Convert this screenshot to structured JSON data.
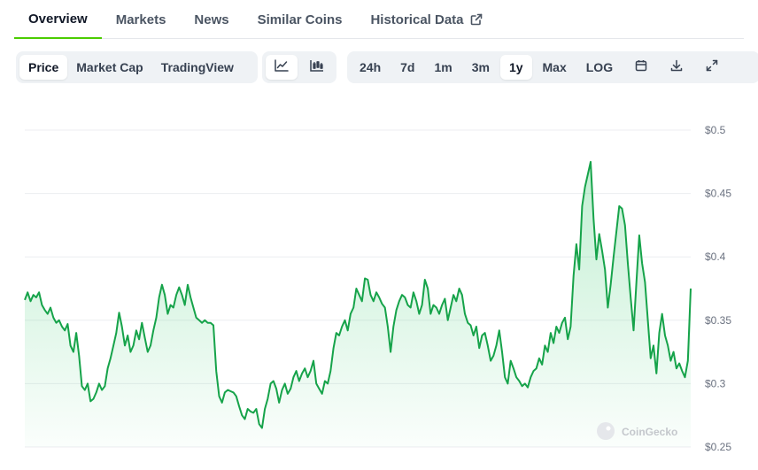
{
  "tabs": [
    {
      "label": "Overview",
      "active": true
    },
    {
      "label": "Markets",
      "active": false
    },
    {
      "label": "News",
      "active": false
    },
    {
      "label": "Similar Coins",
      "active": false
    },
    {
      "label": "Historical Data",
      "active": false,
      "external": true
    }
  ],
  "chart_type_buttons": [
    {
      "label": "Price",
      "active": true
    },
    {
      "label": "Market Cap",
      "active": false
    },
    {
      "label": "TradingView",
      "active": false
    }
  ],
  "view_icons": [
    {
      "icon": "line-chart-icon",
      "active": true
    },
    {
      "icon": "candlestick-chart-icon",
      "active": false
    }
  ],
  "range_buttons": [
    {
      "label": "24h",
      "active": false
    },
    {
      "label": "7d",
      "active": false
    },
    {
      "label": "1m",
      "active": false
    },
    {
      "label": "3m",
      "active": false
    },
    {
      "label": "1y",
      "active": true
    },
    {
      "label": "Max",
      "active": false
    },
    {
      "label": "LOG",
      "active": false
    }
  ],
  "tool_icons": [
    "calendar-icon",
    "download-icon",
    "expand-icon"
  ],
  "watermark": "CoinGecko",
  "colors": {
    "line": "#16a34a",
    "accent": "#4bcc00"
  },
  "chart_data": {
    "type": "area",
    "x_count": 220,
    "y_values": [
      0.366,
      0.372,
      0.365,
      0.37,
      0.368,
      0.372,
      0.362,
      0.358,
      0.355,
      0.36,
      0.352,
      0.348,
      0.35,
      0.345,
      0.342,
      0.347,
      0.33,
      0.325,
      0.34,
      0.322,
      0.298,
      0.295,
      0.3,
      0.286,
      0.288,
      0.293,
      0.3,
      0.295,
      0.298,
      0.312,
      0.32,
      0.33,
      0.34,
      0.356,
      0.345,
      0.33,
      0.338,
      0.325,
      0.33,
      0.342,
      0.335,
      0.348,
      0.336,
      0.325,
      0.33,
      0.342,
      0.352,
      0.368,
      0.378,
      0.37,
      0.355,
      0.362,
      0.36,
      0.37,
      0.376,
      0.37,
      0.362,
      0.378,
      0.368,
      0.36,
      0.352,
      0.35,
      0.348,
      0.35,
      0.348,
      0.348,
      0.346,
      0.31,
      0.29,
      0.285,
      0.293,
      0.295,
      0.294,
      0.293,
      0.29,
      0.282,
      0.275,
      0.272,
      0.28,
      0.278,
      0.277,
      0.28,
      0.268,
      0.265,
      0.28,
      0.288,
      0.3,
      0.302,
      0.296,
      0.285,
      0.295,
      0.3,
      0.292,
      0.296,
      0.305,
      0.31,
      0.302,
      0.308,
      0.312,
      0.305,
      0.31,
      0.318,
      0.3,
      0.296,
      0.292,
      0.302,
      0.3,
      0.31,
      0.328,
      0.34,
      0.338,
      0.345,
      0.35,
      0.342,
      0.355,
      0.36,
      0.375,
      0.37,
      0.365,
      0.383,
      0.382,
      0.37,
      0.365,
      0.372,
      0.368,
      0.363,
      0.36,
      0.345,
      0.325,
      0.345,
      0.358,
      0.365,
      0.37,
      0.368,
      0.362,
      0.36,
      0.372,
      0.365,
      0.355,
      0.362,
      0.382,
      0.375,
      0.355,
      0.362,
      0.36,
      0.355,
      0.362,
      0.367,
      0.35,
      0.36,
      0.37,
      0.365,
      0.375,
      0.37,
      0.355,
      0.348,
      0.346,
      0.338,
      0.345,
      0.328,
      0.338,
      0.34,
      0.33,
      0.318,
      0.322,
      0.33,
      0.342,
      0.325,
      0.305,
      0.3,
      0.318,
      0.312,
      0.305,
      0.302,
      0.298,
      0.3,
      0.297,
      0.305,
      0.31,
      0.312,
      0.32,
      0.315,
      0.33,
      0.325,
      0.34,
      0.332,
      0.345,
      0.34,
      0.348,
      0.352,
      0.335,
      0.345,
      0.385,
      0.41,
      0.39,
      0.44,
      0.455,
      0.465,
      0.475,
      0.43,
      0.398,
      0.418,
      0.405,
      0.39,
      0.36,
      0.378,
      0.4,
      0.42,
      0.44,
      0.438,
      0.425,
      0.395,
      0.368,
      0.342,
      0.38,
      0.417,
      0.395,
      0.38,
      0.35,
      0.32,
      0.33,
      0.308,
      0.34,
      0.355,
      0.338,
      0.33,
      0.318,
      0.325,
      0.312,
      0.316,
      0.31,
      0.305,
      0.318,
      0.375
    ],
    "ylim": [
      0.25,
      0.5
    ],
    "yticks": [
      "$0.5",
      "$0.45",
      "$0.4",
      "$0.35",
      "$0.3",
      "$0.25"
    ],
    "ytick_values": [
      0.5,
      0.45,
      0.4,
      0.35,
      0.3,
      0.25
    ],
    "grid": true,
    "axis_side": "right"
  }
}
